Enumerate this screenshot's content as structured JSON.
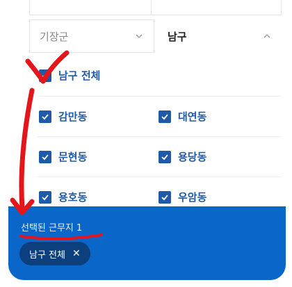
{
  "filters": {
    "district_select": {
      "value": "기장군",
      "expanded": false
    },
    "gu_select": {
      "value": "남구",
      "expanded": true
    }
  },
  "options": [
    {
      "label": "남구 전체",
      "checked": true
    },
    {
      "label": "감만동",
      "checked": true
    },
    {
      "label": "대연동",
      "checked": true
    },
    {
      "label": "문현동",
      "checked": true
    },
    {
      "label": "용당동",
      "checked": true
    },
    {
      "label": "용호동",
      "checked": true
    },
    {
      "label": "우암동",
      "checked": true
    }
  ],
  "bottom": {
    "selected_count_label": "선택된 근무지 1",
    "chip_label": "남구 전체"
  },
  "colors": {
    "accent": "#1f5aa8",
    "bar": "#0a66c8",
    "chip": "#0b3f7e",
    "annotation": "#e3161b"
  },
  "icons": {
    "district_chevron": "chevron-down-icon",
    "gu_chevron": "chevron-up-icon",
    "chip_remove": "close-icon",
    "checkbox": "check-icon"
  }
}
